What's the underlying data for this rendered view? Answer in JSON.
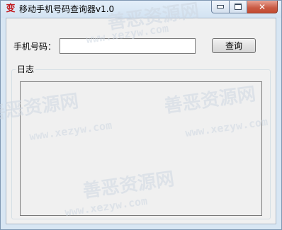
{
  "window": {
    "title": "移动手机号码查询器v1.0",
    "app_icon_glyph": "变",
    "controls": {
      "minimize_icon": "minimize-icon",
      "maximize_icon": "maximize-icon",
      "close_icon": "close-icon",
      "close_glyph": "✕"
    }
  },
  "form": {
    "phone_label": "手机号码：",
    "phone_value": "",
    "query_button": "查询"
  },
  "log": {
    "legend": "日志",
    "content": ""
  },
  "watermark": {
    "text_cn": "善恶资源网",
    "text_url": "www.xezyw.com"
  },
  "colors": {
    "frame": "#d8e6f3",
    "client_bg": "#f0f0f0",
    "close_button": "#c95a43"
  }
}
